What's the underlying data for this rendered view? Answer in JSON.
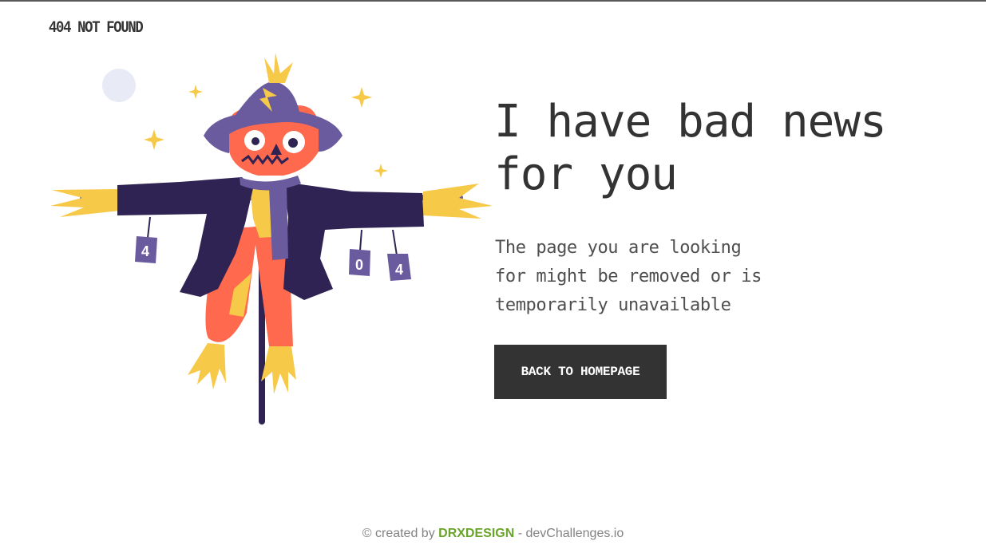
{
  "header": {
    "brand": "404 NOT FOUND"
  },
  "hero": {
    "headline_line1": "I have bad news",
    "headline_line2": "for you",
    "description_line1": "The page you are looking",
    "description_line2": "for might be removed or is",
    "description_line3": "temporarily unavailable",
    "cta_label": "BACK TO HOMEPAGE"
  },
  "illustration": {
    "can_labels": [
      "4",
      "0",
      "4"
    ]
  },
  "footer": {
    "prefix": "© created by ",
    "author": "DRXDESIGN",
    "separator": " - ",
    "site": "devChallenges.io"
  },
  "colors": {
    "text_dark": "#333333",
    "button_bg": "#333333",
    "credit_green": "#6aa32a",
    "hat_purple": "#6a5a9e",
    "coat_navy": "#2e2352",
    "skin_orange": "#ff6a4f",
    "straw_yellow": "#f7c948"
  }
}
